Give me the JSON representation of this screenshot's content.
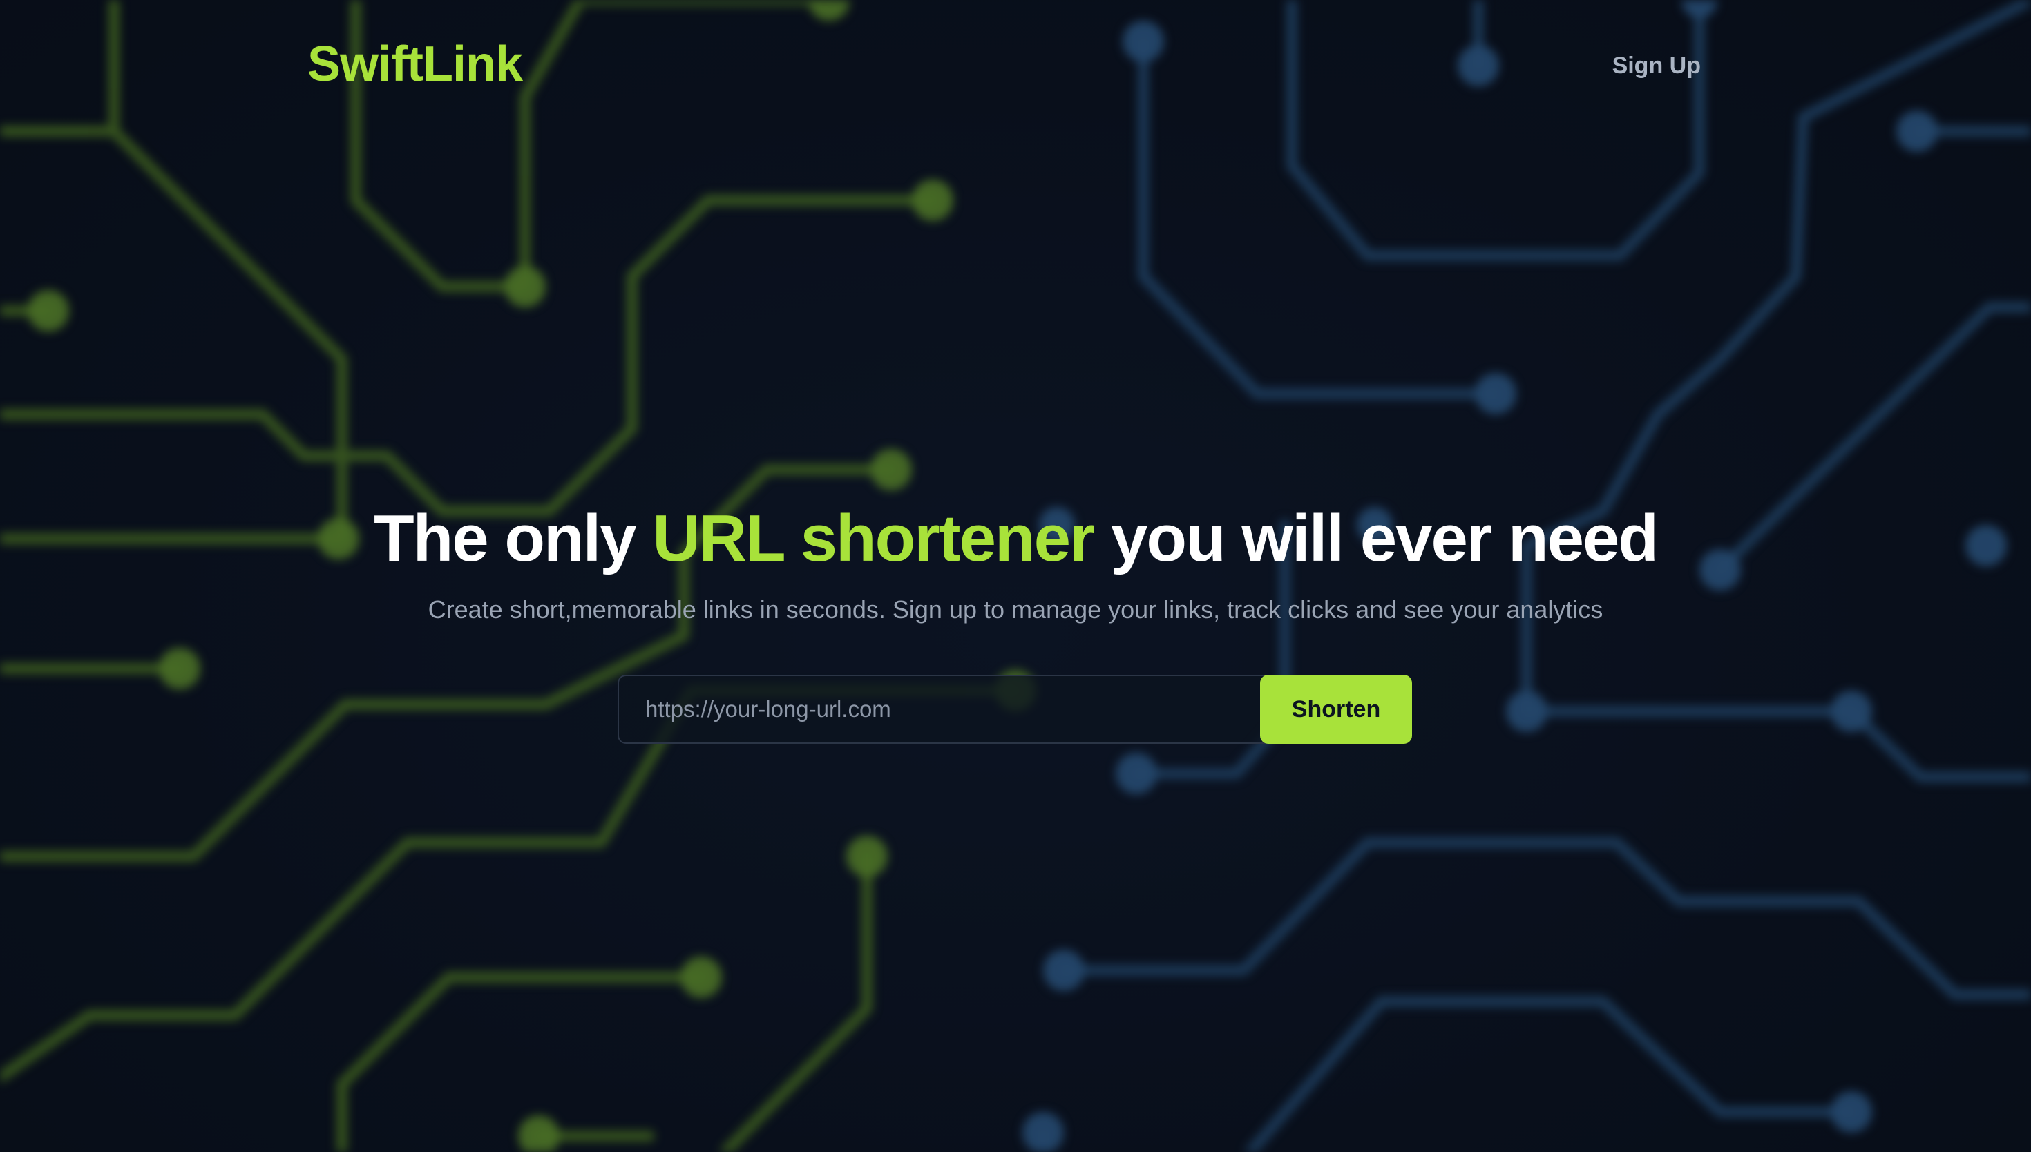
{
  "header": {
    "logo": "SwiftLink",
    "signup_label": "Sign Up"
  },
  "hero": {
    "headline_before": "The only ",
    "headline_accent": "URL shortener",
    "headline_after": " you will ever need",
    "subtitle": "Create short,memorable links in seconds. Sign up to manage your links, track clicks and see your analytics"
  },
  "form": {
    "url_placeholder": "https://your-long-url.com",
    "url_value": "",
    "submit_label": "Shorten"
  },
  "colors": {
    "accent": "#a8e23a",
    "background": "#0a111d",
    "circuit_green": "#5f8f2a",
    "circuit_blue": "#2d5a86"
  }
}
